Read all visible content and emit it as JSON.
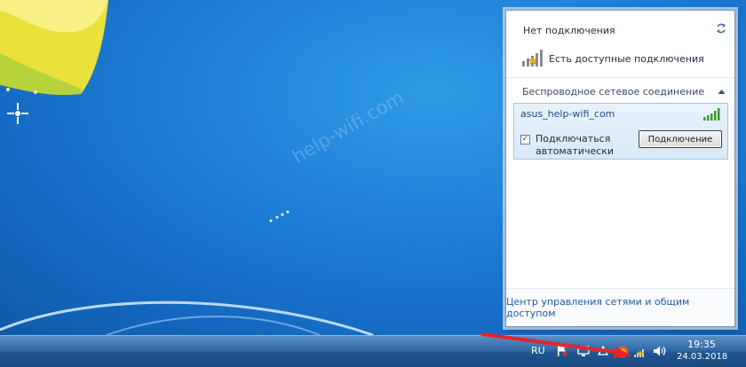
{
  "popup": {
    "status_title": "Нет подключения",
    "available_text": "Есть доступные подключения",
    "section_label": "Беспроводное сетевое соединение",
    "network": {
      "ssid": "asus_help-wifi_com",
      "auto_connect_label": "Подключаться автоматически",
      "auto_connect_checked": true,
      "connect_button": "Подключение"
    },
    "footer_link": "Центр управления сетями и общим доступом"
  },
  "watermark": "help-wifi.com",
  "taskbar": {
    "language": "RU",
    "clock_time": "19:35",
    "clock_date": "24.03.2018"
  },
  "icons": {
    "refresh": "refresh-icon",
    "signal_available": "signal-star-icon",
    "signal": "signal-bars-icon",
    "collapse": "chevron-up-icon",
    "flag": "flag-icon",
    "network_tray": "network-tray-icon",
    "volume": "speaker-icon"
  },
  "colors": {
    "desktop": "#1e7fd6",
    "signal_green": "#3a9a2a",
    "link": "#1e5aa8",
    "arrow": "#e8232a"
  }
}
